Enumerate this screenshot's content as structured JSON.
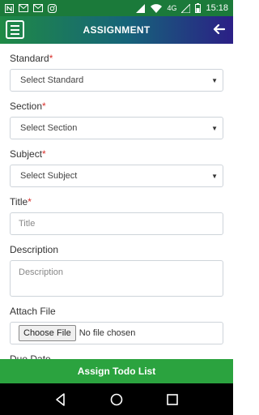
{
  "status_bar": {
    "time": "15:18",
    "network_label": "4G",
    "icons": [
      "notification-n-icon",
      "gmail-icon",
      "gmail-icon",
      "instagram-icon",
      "signal-4g-icon",
      "wifi-icon",
      "signal-icon",
      "battery-icon"
    ]
  },
  "app_bar": {
    "title": "ASSIGNMENT",
    "menu_icon": "menu-icon",
    "back_icon": "back-arrow-icon"
  },
  "form": {
    "standard": {
      "label": "Standard",
      "required": "*",
      "selected": "Select Standard"
    },
    "section": {
      "label": "Section",
      "required": "*",
      "selected": "Select Section"
    },
    "subject": {
      "label": "Subject",
      "required": "*",
      "selected": "Select Subject"
    },
    "title": {
      "label": "Title",
      "required": "*",
      "placeholder": "Title"
    },
    "description": {
      "label": "Description",
      "placeholder": "Description"
    },
    "attach_file": {
      "label": "Attach File",
      "button": "Choose File",
      "status": "No file chosen"
    },
    "due_date": {
      "label": "Due Date"
    }
  },
  "action": {
    "label": "Assign Todo List"
  },
  "colors": {
    "status_bar": "#1b7a3a",
    "app_bar_start": "#1f8a45",
    "app_bar_end": "#2b1f86",
    "required": "#d9302c",
    "action_button": "#2ba33f"
  }
}
